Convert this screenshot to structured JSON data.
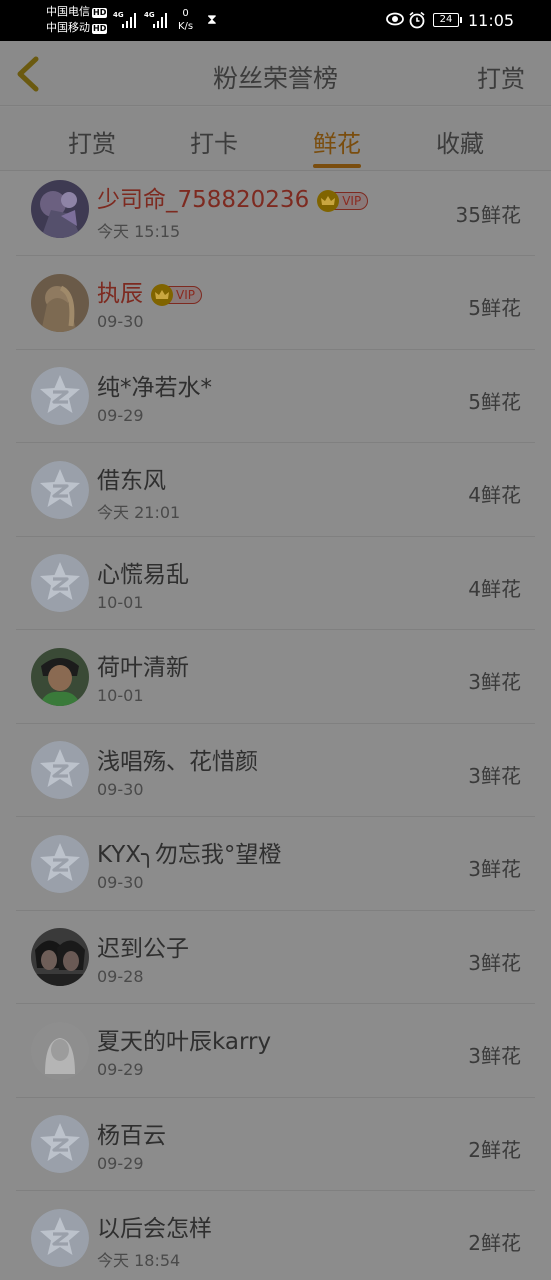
{
  "status_bar": {
    "carrier1": "中国电信",
    "carrier2": "中国移动",
    "hd": "HD",
    "net1": "4G",
    "net2": "4G",
    "speed_value": "0",
    "speed_unit": "K/s",
    "battery": "24",
    "time": "11:05"
  },
  "header": {
    "title": "粉丝荣誉榜",
    "right_action": "打赏"
  },
  "tabs": [
    {
      "label": "打赏",
      "active": false
    },
    {
      "label": "打卡",
      "active": false
    },
    {
      "label": "鲜花",
      "active": true
    },
    {
      "label": "收藏",
      "active": false
    }
  ],
  "vip_label": "VIP",
  "fans": [
    {
      "name": "少司命_758820236",
      "time": "今天 15:15",
      "count": "35鲜花",
      "vip": true,
      "avatar": "anime-avatar"
    },
    {
      "name": "执辰",
      "time": "09-30",
      "count": "5鲜花",
      "vip": true,
      "avatar": "girl-avatar"
    },
    {
      "name": "纯*净若水*",
      "time": "09-29",
      "count": "5鲜花",
      "vip": false,
      "avatar": "default-avatar"
    },
    {
      "name": "借东风",
      "time": "今天 21:01",
      "count": "4鲜花",
      "vip": false,
      "avatar": "default-avatar"
    },
    {
      "name": "心慌易乱",
      "time": "10-01",
      "count": "4鲜花",
      "vip": false,
      "avatar": "default-avatar"
    },
    {
      "name": "荷叶清新",
      "time": "10-01",
      "count": "3鲜花",
      "vip": false,
      "avatar": "boy-avatar"
    },
    {
      "name": "浅唱殇、花惜颜",
      "time": "09-30",
      "count": "3鲜花",
      "vip": false,
      "avatar": "default-avatar"
    },
    {
      "name": "KYX╮勿忘我°望橙",
      "time": "09-30",
      "count": "3鲜花",
      "vip": false,
      "avatar": "default-avatar"
    },
    {
      "name": "迟到公子",
      "time": "09-28",
      "count": "3鲜花",
      "vip": false,
      "avatar": "couple-avatar"
    },
    {
      "name": "夏天的叶辰karry",
      "time": "09-29",
      "count": "3鲜花",
      "vip": false,
      "avatar": "silhouette-avatar"
    },
    {
      "name": "杨百云",
      "time": "09-29",
      "count": "2鲜花",
      "vip": false,
      "avatar": "default-avatar"
    },
    {
      "name": "以后会怎样",
      "time": "今天 18:54",
      "count": "2鲜花",
      "vip": false,
      "avatar": "default-avatar"
    }
  ]
}
